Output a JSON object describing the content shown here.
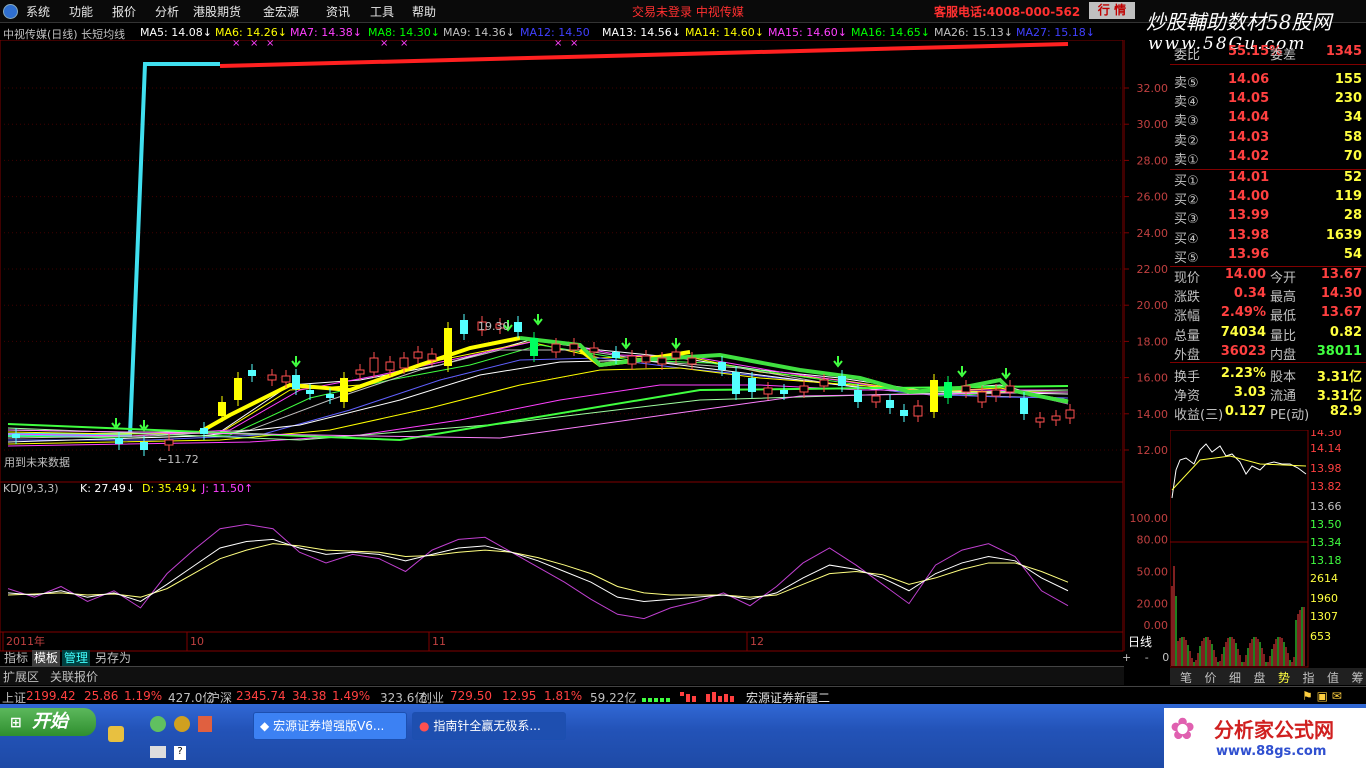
{
  "menu": {
    "items": [
      "系统",
      "功能",
      "报价",
      "分析",
      "港股期货",
      "金宏源",
      "资讯",
      "工具",
      "帮助"
    ],
    "login_status": "交易未登录 中视传媒",
    "service_phone": "客服电话:4008-000-562",
    "quote_button": "行 情",
    "brand_line1": "炒股輔助数材58股网",
    "brand_line2": "www.58Gu.com"
  },
  "chart": {
    "stock_title": "中视传媒(日线) 长短均线",
    "ma_labels": [
      {
        "text": "MA5: 14.08↓",
        "color": "#ffffff"
      },
      {
        "text": "MA6: 14.26↓",
        "color": "#ffff00"
      },
      {
        "text": "MA7: 14.38↓",
        "color": "#ff40ff"
      },
      {
        "text": "MA8: 14.30↓",
        "color": "#00ff00"
      },
      {
        "text": "MA9: 14.36↓",
        "color": "#c0c0c0"
      },
      {
        "text": "MA12: 14.50",
        "color": "#4040ff"
      },
      {
        "text": "MA13: 14.56↓",
        "color": "#ffffff"
      },
      {
        "text": "MA14: 14.60↓",
        "color": "#ffff00"
      },
      {
        "text": "MA15: 14.60↓",
        "color": "#ff40ff"
      },
      {
        "text": "MA16: 14.65↓",
        "color": "#00ff00"
      },
      {
        "text": "MA26: 15.13↓",
        "color": "#c0c0c0"
      },
      {
        "text": "MA27: 15.18↓",
        "color": "#4040ff"
      }
    ],
    "high_label": "19.30",
    "low_label": "←11.72",
    "future_note": "用到未来数据",
    "kdj_label": "KDJ(9,3,3)",
    "kdj_values": [
      {
        "text": "K: 27.49↓",
        "color": "#ffffff"
      },
      {
        "text": "D: 35.49↓",
        "color": "#ffff00"
      },
      {
        "text": "J: 11.50↑",
        "color": "#ff40ff"
      }
    ],
    "time_labels": [
      "2011年",
      "10",
      "11",
      "12"
    ],
    "price_axis": [
      "32.00",
      "30.00",
      "28.00",
      "26.00",
      "24.00",
      "22.00",
      "20.00",
      "18.00",
      "16.00",
      "14.00",
      "12.00"
    ],
    "kdj_axis": [
      "100.00",
      "80.00",
      "50.00",
      "20.00",
      "0.00"
    ]
  },
  "quote_panel": {
    "top_partial": {
      "label": "委比",
      "value": "55.15%",
      "label2": "委差",
      "value2": "1345"
    },
    "sells": [
      {
        "label": "卖⑤",
        "price": "14.06",
        "vol": "155"
      },
      {
        "label": "卖④",
        "price": "14.05",
        "vol": "230"
      },
      {
        "label": "卖③",
        "price": "14.04",
        "vol": "34"
      },
      {
        "label": "卖②",
        "price": "14.03",
        "vol": "58"
      },
      {
        "label": "卖①",
        "price": "14.02",
        "vol": "70"
      }
    ],
    "buys": [
      {
        "label": "买①",
        "price": "14.01",
        "vol": "52"
      },
      {
        "label": "买②",
        "price": "14.00",
        "vol": "119"
      },
      {
        "label": "买③",
        "price": "13.99",
        "vol": "28"
      },
      {
        "label": "买④",
        "price": "13.98",
        "vol": "1639"
      },
      {
        "label": "买⑤",
        "price": "13.96",
        "vol": "54"
      }
    ],
    "stats": [
      {
        "l1": "现价",
        "v1": "14.00",
        "c1": "#ff4040",
        "l2": "今开",
        "v2": "13.67",
        "c2": "#ff4040"
      },
      {
        "l1": "涨跌",
        "v1": "0.34",
        "c1": "#ff4040",
        "l2": "最高",
        "v2": "14.30",
        "c2": "#ff4040"
      },
      {
        "l1": "涨幅",
        "v1": "2.49%",
        "c1": "#ff4040",
        "l2": "最低",
        "v2": "13.67",
        "c2": "#ff4040"
      },
      {
        "l1": "总量",
        "v1": "74034",
        "c1": "#ffff40",
        "l2": "量比",
        "v2": "0.82",
        "c2": "#ffff40"
      },
      {
        "l1": "外盘",
        "v1": "36023",
        "c1": "#ff4040",
        "l2": "内盘",
        "v2": "38011",
        "c2": "#40ff40"
      },
      {
        "l1": "换手",
        "v1": "2.23%",
        "c1": "#ffff40",
        "l2": "股本",
        "v2": "3.31亿",
        "c2": "#ffff40"
      },
      {
        "l1": "净资",
        "v1": "3.03",
        "c1": "#ffff40",
        "l2": "流通",
        "v2": "3.31亿",
        "c2": "#ffff40"
      },
      {
        "l1": "收益(三)",
        "v1": "0.127",
        "c1": "#ffff40",
        "l2": "PE(动)",
        "v2": "82.9",
        "c2": "#ffff40"
      }
    ],
    "mini_axis": [
      "14.30",
      "14.14",
      "13.98",
      "13.82",
      "13.66",
      "13.50",
      "13.34",
      "13.18",
      "2614",
      "1960",
      "1307",
      "653"
    ],
    "mini_tabs": [
      "笔",
      "价",
      "细",
      "盘",
      "势",
      "指",
      "值",
      "筹"
    ]
  },
  "bottom_tabs": {
    "tabs": [
      "指标",
      "模板",
      "管理",
      "另存为"
    ],
    "ext_tabs": [
      "扩展区",
      "关联报价"
    ],
    "panel_btn": "日线",
    "zoom": [
      "+",
      "-",
      "0"
    ]
  },
  "status": {
    "sh": {
      "name": "上证",
      "value": "2199.42",
      "chg": "25.86",
      "pct": "1.19%",
      "amt": "427.0亿"
    },
    "sz": {
      "name": "沪深",
      "value": "2345.74",
      "chg": "34.38",
      "pct": "1.49%",
      "amt": "323.6亿"
    },
    "cy": {
      "name": "创业",
      "value": "729.50",
      "chg": "12.95",
      "pct": "1.81%",
      "amt": "59.22亿"
    },
    "server": "宏源证券新疆二"
  },
  "taskbar": {
    "start_label": "开始",
    "tasks": [
      "宏源证券增强版V6...",
      "指南针全赢无极系..."
    ],
    "logo_text": "分析家公式网",
    "logo_url_text": "www.88gs.com"
  }
}
